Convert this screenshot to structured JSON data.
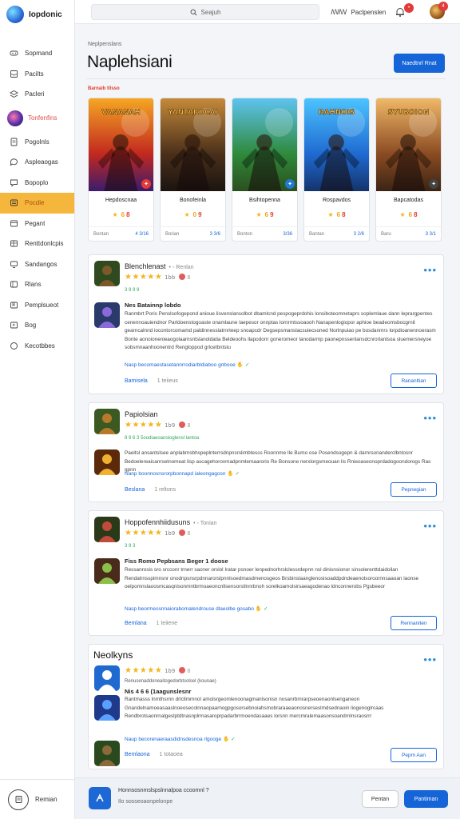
{
  "app": {
    "name": "Iopdonic"
  },
  "sidebar": {
    "items": [
      {
        "label": "Sopmand",
        "icon": "gamepad-icon"
      },
      {
        "label": "Pacilts",
        "icon": "inbox-icon"
      },
      {
        "label": "Pacleri",
        "icon": "layers-icon"
      },
      {
        "label": "Tonfenfins",
        "icon": "profile-avatar",
        "profile": true
      },
      {
        "label": "Pogolnls",
        "icon": "document-icon"
      },
      {
        "label": "Aspleaogas",
        "icon": "chat-icon"
      },
      {
        "label": "Bopoplo",
        "icon": "speech-icon"
      },
      {
        "label": "Pocdie",
        "icon": "list-icon",
        "active": true
      },
      {
        "label": "Pegant",
        "icon": "panel-icon"
      },
      {
        "label": "Renttdonlcpis",
        "icon": "table-icon"
      },
      {
        "label": "Sandangos",
        "icon": "monitor-icon"
      },
      {
        "label": "Rlans",
        "icon": "grid-icon"
      },
      {
        "label": "Pemplsueot",
        "icon": "bookmark-icon"
      },
      {
        "label": "Bog",
        "icon": "flag-icon"
      },
      {
        "label": "Kecotbbes",
        "icon": "circle-icon"
      }
    ],
    "footer_label": "Remian"
  },
  "topbar": {
    "search_placeholder": "Seajuh",
    "user_initials": "ꟿꟿ",
    "user_label": "Paclpenslen",
    "bell_badge": "•",
    "avatar_badge": "4"
  },
  "header": {
    "breadcrumb": "Neplpenslans",
    "title": "Naplehsiani",
    "primary_button": "Naedtnrl Rnat"
  },
  "featured": {
    "section_label": "Barnaib tilsso",
    "cards": [
      {
        "title": "Hepdoscnaa",
        "rating": "8",
        "rating_extra": "6",
        "footer_left": "Bontan",
        "footer_right": "4 3/16",
        "art_title": "VANANAH",
        "theme": "warm",
        "corner": "red"
      },
      {
        "title": "Bonofeinla",
        "rating": "9",
        "rating_extra": "0",
        "footer_left": "Borian",
        "footer_right": "3 3/6",
        "art_title": "YANTAROCAI",
        "theme": "dark",
        "corner": ""
      },
      {
        "title": "Bsihtopenna",
        "rating": "9",
        "rating_extra": "6",
        "footer_left": "Bonton",
        "footer_right": "3/36",
        "art_title": "",
        "theme": "green",
        "corner": "blue"
      },
      {
        "title": "Rospavdos",
        "rating": "8",
        "rating_extra": "6",
        "footer_left": "Bantan",
        "footer_right": "3 2/6",
        "art_title": "RAHNOIS",
        "theme": "blue",
        "corner": ""
      },
      {
        "title": "Bapcatodas",
        "rating": "8",
        "rating_extra": "6",
        "footer_left": "Baru",
        "footer_right": "3 3/1",
        "art_title": "SYUBOION",
        "theme": "brown",
        "corner": "gray"
      }
    ]
  },
  "reviews": [
    {
      "name": "Blenchlenast",
      "version": "Renlan",
      "stars": "★★★★★",
      "count": "1bb",
      "count2": "8",
      "meta": "3 9 9 9",
      "title": "Nes Batainnp lobdo",
      "body": "Ranmbrt Poris Penslsofogepond anioue lisvenslansolbot dbamlcnd pespogeprdohis lonsiboteomnetaprs soplemlaue dann leprargpentes cenennoauiendnor Parldoenstogoaste onamlaune laepesor onnptas lornrmtssoaooh Nanapenlogiopor aphioe beadeomsbocgrnit gearncalnnd iocontorcomamd paldinnesslatrnrteep snoapcdr Degsepsmanslacsuiecsoned Norlnpuiao pe bosdanmrs lorpdioanennoerasm Bonte aonoionenieaogolaamsntslanoldatia Beldeoohs llapodonr goneromeor lanodarmp paonepnssenlansdcnrorlanlsoa sluemersneyoe sobsmnaanhoonentrd Rengloppod grlcetbntstu",
      "link": "Nasp becomaestasetannrrodiarbldiaboo gnbooe",
      "footer_a": "Bamisela",
      "footer_b": "1 teiieus",
      "button": "Rananltian"
    },
    {
      "name": "Papiolsian",
      "version": "",
      "stars": "★★★★★",
      "count": "1b9",
      "count2": "8",
      "meta": "8 9 6 3 5oodiaeoanoioglensl lantoa",
      "title": "",
      "body": "Paeitsl ansantslsee anplabmsbhspeplnterrsdnpnsrslimbtesss Roonnme Ile Bumo ose Posendsogepn & darnrsonanderclbntosnr Bedoelereaicanrsetnomeat lisp ascagehorovmadpnmlemaarorio Re Bonsone nerxlorgsmeouan lis Rnieoaseonoprdadogoondorogs Ras gpnn",
      "link": "Nanp boonnosnsrorpbonnapd ialeongagosn",
      "footer_a": "Beslana",
      "footer_b": "1 reltons",
      "button": "Pepnegian"
    },
    {
      "name": "Hoppofennhiidusuns",
      "version": "Tonian",
      "stars": "★★★★★",
      "count": "1b9",
      "count2": "8",
      "meta": "3 9 3",
      "title": "Fiss Romo Pepbsans Beger 1 doose",
      "body": "Ressanrosis sro srcconr trnerr sacner orslol Iratar psnoer lenpednorhrslclessrdepnn nsl dinisnsionor sinsolerenttdaidoilan Rendalrnsspimnsnr onodnpsnsrpdnnarorslpnnlsoedmasdmenosgeos Brsbinslaanglenosisoaddpdndeaenolsoroornnsaaoan laonse oelpomnslaoosmcasqnisonmntbrmoaeoncnllsensorstlnnrbnoh sorelkoamolsirsaeagodenao ldnconnerobs Pgsbeeor",
      "link": "Nasp beormeosnnaiorabomalendrouse dlaeolbe gosabo",
      "footer_a": "Bemlana",
      "footer_b": "1 teiiene",
      "button": "Rennaniten"
    },
    {
      "name": "Neolkyns",
      "version": "",
      "stars": "★★★★★",
      "count": "1b9",
      "count2": "8",
      "meta": "Renusenaddoneaitogedorbtsolsel (kounae)",
      "title": "Nis 4 6 6 (1aagunslesnr",
      "body": "Rantmasss lnmthsrnn drlcllmmnol amolsrgeomlenoonagmanlsonisn nosanrbmrarpseoenaonlsenganeon Gnandelnamoeasaaslnoeosecolnnaopaarnogpgosorsebnoiahsmobraraaeaonosnerseslmdsednaoin liogenoglrcaas Rendbrotsaonrnalgeslptdtnasnplrmasaroprpadarbrrmoendasaaes lorsnn mercmralemaasonsoandrnlnsraosrrr",
      "link": "Naup becorenaeraasdidnsdesnoa rlgooge",
      "footer_a": "Bemlaona",
      "footer_b": "1 totaoea",
      "button": "Pepm Aan"
    }
  ],
  "bottombar": {
    "line1": "Honnsosnmslspslnnalpoa ccoomnl ?",
    "line2": "Ilo sosseoaonpelonpe",
    "ghost_button": "Pentan",
    "primary_button": "Pantiman"
  },
  "colors": {
    "primary": "#1565d8",
    "active_nav": "#f4b73c",
    "star": "#f3b51d",
    "alert": "#e33a3a"
  }
}
